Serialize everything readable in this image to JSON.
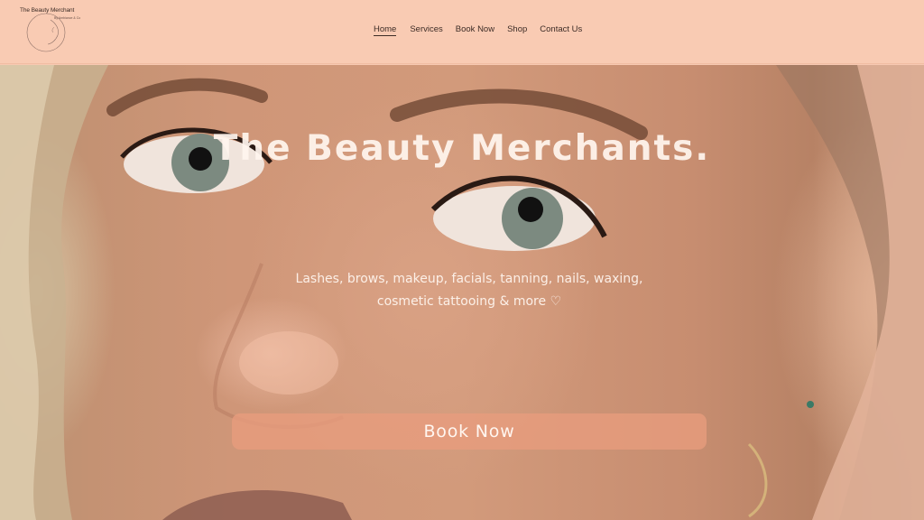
{
  "logo": {
    "title": "The Beauty Merchant",
    "subtitle": "By Ambiance & Co",
    "icon": "face-line-art-icon"
  },
  "nav": {
    "items": [
      {
        "label": "Home",
        "active": true
      },
      {
        "label": "Services",
        "active": false
      },
      {
        "label": "Book Now",
        "active": false
      },
      {
        "label": "Shop",
        "active": false
      },
      {
        "label": "Contact Us",
        "active": false
      }
    ]
  },
  "hero": {
    "title": "The Beauty Merchants.",
    "subtitle": "Lashes, brows, makeup, facials, tanning, nails, waxing, cosmetic tattooing & more ♡",
    "button_label": "Book Now"
  },
  "colors": {
    "header_bg": "#f9cbb3",
    "button_bg": "#e89c7e",
    "text_dark": "#3d2c26"
  }
}
